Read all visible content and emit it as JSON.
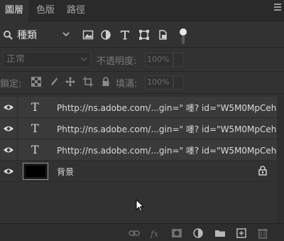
{
  "tabs": [
    {
      "label": "圖層",
      "active": true
    },
    {
      "label": "色版",
      "active": false
    },
    {
      "label": "路徑",
      "active": false
    }
  ],
  "filter": {
    "kind_label": "種類",
    "icons": [
      "image-filter-icon",
      "adjustment-filter-icon",
      "type-filter-icon",
      "shape-filter-icon",
      "smart-object-filter-icon"
    ]
  },
  "blend": {
    "mode": "正常",
    "opacity_label": "不透明度:",
    "opacity_value": "100%"
  },
  "lock": {
    "label": "鎖定:",
    "fill_label": "填滿:",
    "fill_value": "100%"
  },
  "layers": [
    {
      "type": "text",
      "name": "Phttp://ns.adobe.com/...gin=\" 嚜? id=\"W5M0MpCeh"
    },
    {
      "type": "text",
      "name": "Phttp://ns.adobe.com/...gin=\" 嚜? id=\"W5M0MpCeh"
    },
    {
      "type": "text",
      "name": "Phttp://ns.adobe.com/...gin=\" 嚜? id=\"W5M0MpCeh"
    },
    {
      "type": "background",
      "name": "背景",
      "locked": true
    }
  ],
  "type_glyph": "T",
  "colors": {
    "panel": "#323232",
    "tabbar": "#2a2a2a",
    "layer_row": "#3a3a3a",
    "text": "#dcdcdc"
  }
}
